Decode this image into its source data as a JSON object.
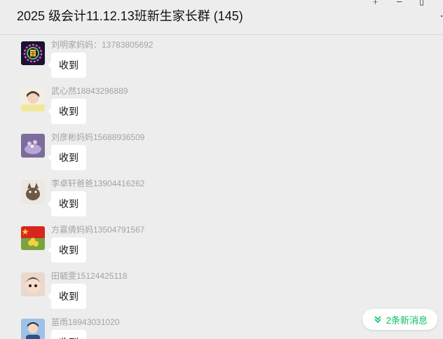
{
  "window": {
    "title": "2025 级会计11.12.13班新生家长群 (145)",
    "controls": {
      "pin": "⍏",
      "minimize": "–",
      "maximize": "▯"
    }
  },
  "messages": [
    {
      "sender": "刘明家妈妈：13783805692",
      "text": "收到",
      "avatar": "avatar-crown"
    },
    {
      "sender": "武心然18843296889",
      "text": "收到",
      "avatar": "avatar-girl"
    },
    {
      "sender": "刘彦彬妈妈15688936509",
      "text": "收到",
      "avatar": "avatar-cake"
    },
    {
      "sender": "李卓轩爸爸13904416262",
      "text": "收到",
      "avatar": "avatar-cat"
    },
    {
      "sender": "方嘉倩妈妈13504791567",
      "text": "收到",
      "avatar": "avatar-flag-flowers"
    },
    {
      "sender": "田毓雯15124425118",
      "text": "收到",
      "avatar": "avatar-child"
    },
    {
      "sender": "苗雨18943031020",
      "text": "收到",
      "avatar": "avatar-person"
    }
  ],
  "new_messages": {
    "label": "2条新消息",
    "icon": "double-chevron-down-icon",
    "color": "#07c160"
  }
}
